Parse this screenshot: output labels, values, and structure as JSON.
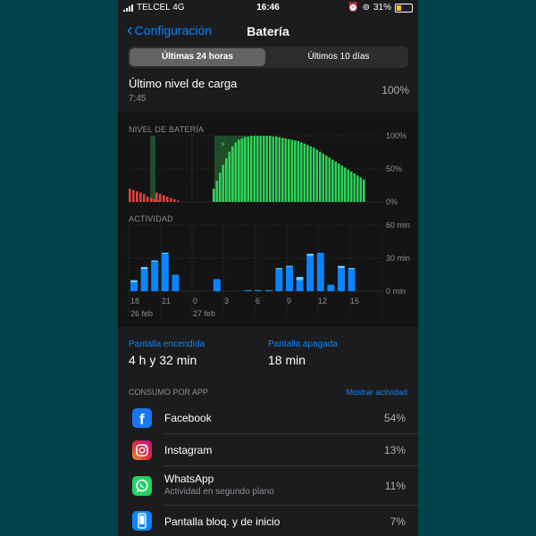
{
  "status": {
    "carrier": "TELCEL 4G",
    "time": "16:46",
    "battery": "31%"
  },
  "nav": {
    "back_label": "Configuración",
    "title": "Batería"
  },
  "segments": [
    "Últimas 24 horas",
    "Últimos 10 días"
  ],
  "last_charge": {
    "label": "Último nivel de carga",
    "time": "7:45",
    "value": "100%"
  },
  "battery_chart": {
    "label": "NIVEL DE BATERÍA",
    "y_ticks": [
      "100%",
      "50%",
      "0%"
    ]
  },
  "activity_chart": {
    "label": "ACTIVIDAD",
    "y_ticks": [
      "60 min",
      "30 min",
      "0 min"
    ],
    "x_ticks": [
      "18",
      "21",
      "0",
      "3",
      "6",
      "9",
      "12",
      "15"
    ],
    "dates": [
      "26 feb",
      "27 feb"
    ]
  },
  "screen_on": {
    "label": "Pantalla encendida",
    "value": "4 h y 32 min"
  },
  "screen_off": {
    "label": "Pantalla apagada",
    "value": "18 min"
  },
  "consumo": {
    "label": "CONSUMO POR APP",
    "link": "Mostrar actividad"
  },
  "apps": [
    {
      "name": "Facebook",
      "sub": "",
      "pct": "54%",
      "icon": "facebook-icon",
      "color": "#1877f2"
    },
    {
      "name": "Instagram",
      "sub": "",
      "pct": "13%",
      "icon": "instagram-icon",
      "color": "#c13584"
    },
    {
      "name": "WhatsApp",
      "sub": "Actividad en segundo plano",
      "pct": "11%",
      "icon": "whatsapp-icon",
      "color": "#25d366"
    },
    {
      "name": "Pantalla bloq. y de inicio",
      "sub": "",
      "pct": "7%",
      "icon": "phone-screen-icon",
      "color": "#0a84ff"
    }
  ],
  "chart_data": [
    {
      "type": "bar",
      "title": "NIVEL DE BATERÍA",
      "ylim": [
        0,
        100
      ],
      "unit": "%",
      "groups": [
        {
          "color": "#e0443a",
          "values": [
            20,
            18,
            16,
            14,
            12,
            8,
            6,
            4,
            2,
            0,
            14,
            12,
            10,
            8,
            6,
            4,
            2
          ]
        },
        {
          "color": "#30d158",
          "values": [
            20,
            32,
            44,
            56,
            66,
            76,
            84,
            90,
            94,
            96,
            98,
            99,
            100,
            100,
            100,
            100,
            100,
            100,
            100,
            99,
            99,
            98,
            97,
            96,
            95,
            94,
            93,
            92,
            90,
            88,
            86,
            84,
            82,
            79,
            76,
            73,
            70,
            67,
            64,
            61,
            58,
            55,
            52,
            49,
            46,
            43,
            40,
            37,
            34
          ]
        }
      ]
    },
    {
      "type": "bar",
      "title": "ACTIVIDAD",
      "ylim": [
        0,
        60
      ],
      "unit": "min",
      "series": [
        {
          "name": "",
          "color": "#0a84ff",
          "values": [
            8,
            20,
            27,
            34,
            15,
            0,
            0,
            0,
            11,
            0,
            0,
            1,
            1,
            1,
            20,
            22,
            10,
            32,
            35,
            6,
            21,
            20
          ]
        },
        {
          "name": "",
          "color": "#64d2ff",
          "values": [
            2,
            2,
            1,
            1,
            0,
            0,
            0,
            0,
            0,
            0,
            0,
            0,
            0,
            0,
            1,
            1,
            3,
            2,
            0,
            0,
            2,
            1
          ]
        }
      ]
    }
  ]
}
